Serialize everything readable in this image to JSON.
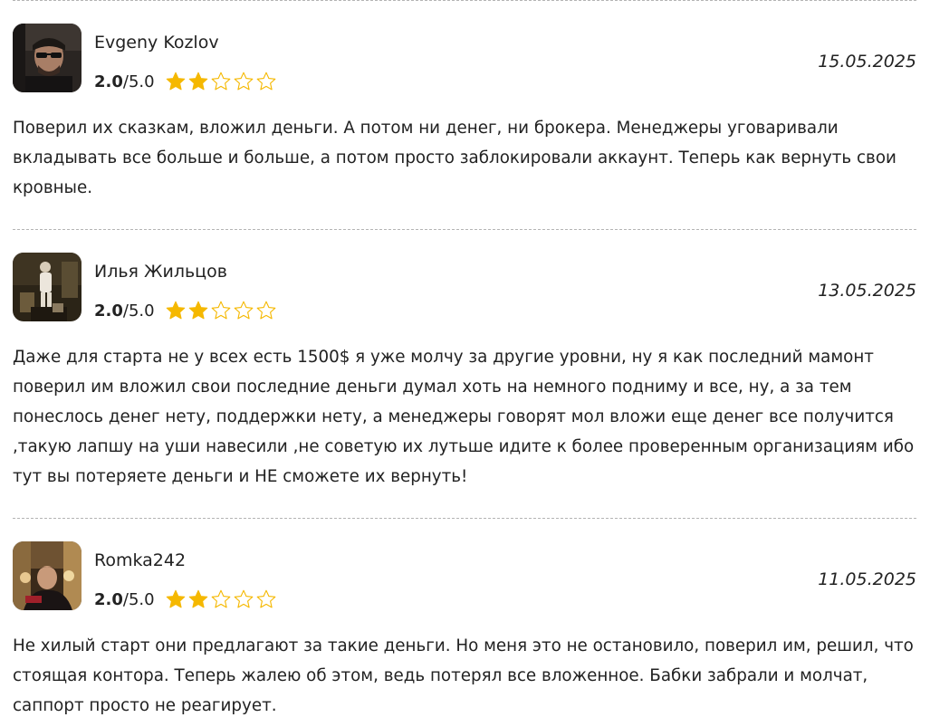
{
  "reviews": [
    {
      "author": "Evgeny Kozlov",
      "score": "2.0",
      "max": "/5.0",
      "rating": 2,
      "date": "15.05.2025",
      "text": "Поверил их сказкам, вложил деньги. А потом ни денег, ни брокера. Менеджеры уговаривали вкладывать все больше и больше, а потом просто заблокировали аккаунт. Теперь как вернуть свои кровные."
    },
    {
      "author": "Илья Жильцов",
      "score": "2.0",
      "max": "/5.0",
      "rating": 2,
      "date": "13.05.2025",
      "text": "Даже для старта не у всех есть 1500$ я уже молчу за другие уровни, ну я как последний мамонт поверил им вложил свои последние деньги думал хоть на немного подниму и все, ну, а за тем понеслось денег нету, поддержки нету, а менеджеры говорят мол вложи еще денег все получится ,такую лапшу на уши навесили ,не советую их лутьше идите к более проверенным организациям ибо тут вы потеряете деньги и НЕ сможете их вернуть!"
    },
    {
      "author": "Romka242",
      "score": "2.0",
      "max": "/5.0",
      "rating": 2,
      "date": "11.05.2025",
      "text": "Не хилый старт они предлагают за такие деньги. Но меня это не остановило, поверил им, решил, что стоящая контора. Теперь жалею об этом, ведь потерял все вложенное. Бабки забрали и молчат, саппорт просто не реагирует."
    }
  ],
  "colors": {
    "star_filled": "#f5b800",
    "star_outline": "#f5b800",
    "divider": "#b4b4b4"
  }
}
